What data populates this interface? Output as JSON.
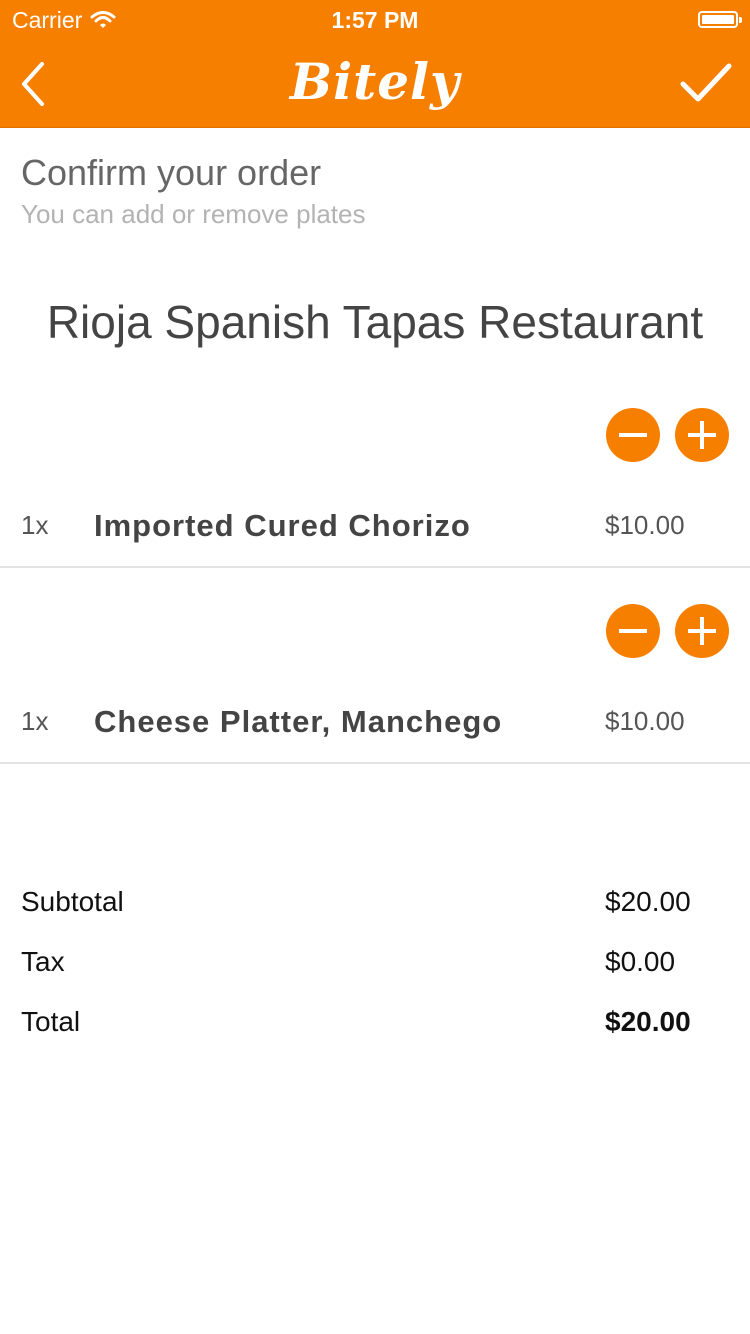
{
  "status_bar": {
    "carrier": "Carrier",
    "time": "1:57 PM"
  },
  "nav": {
    "title": "Bitely",
    "back_icon": "chevron-left-icon",
    "confirm_icon": "checkmark-icon"
  },
  "intro": {
    "title": "Confirm your order",
    "subtitle": "You can add or remove plates"
  },
  "restaurant": {
    "name": "Rioja Spanish Tapas Restaurant"
  },
  "items": [
    {
      "qty": "1x",
      "name": "Imported Cured Chorizo",
      "price": "$10.00"
    },
    {
      "qty": "1x",
      "name": "Cheese Platter, Manchego",
      "price": "$10.00"
    }
  ],
  "summary": {
    "subtotal_label": "Subtotal",
    "subtotal_value": "$20.00",
    "tax_label": "Tax",
    "tax_value": "$0.00",
    "total_label": "Total",
    "total_value": "$20.00"
  },
  "colors": {
    "accent": "#f77f00"
  }
}
